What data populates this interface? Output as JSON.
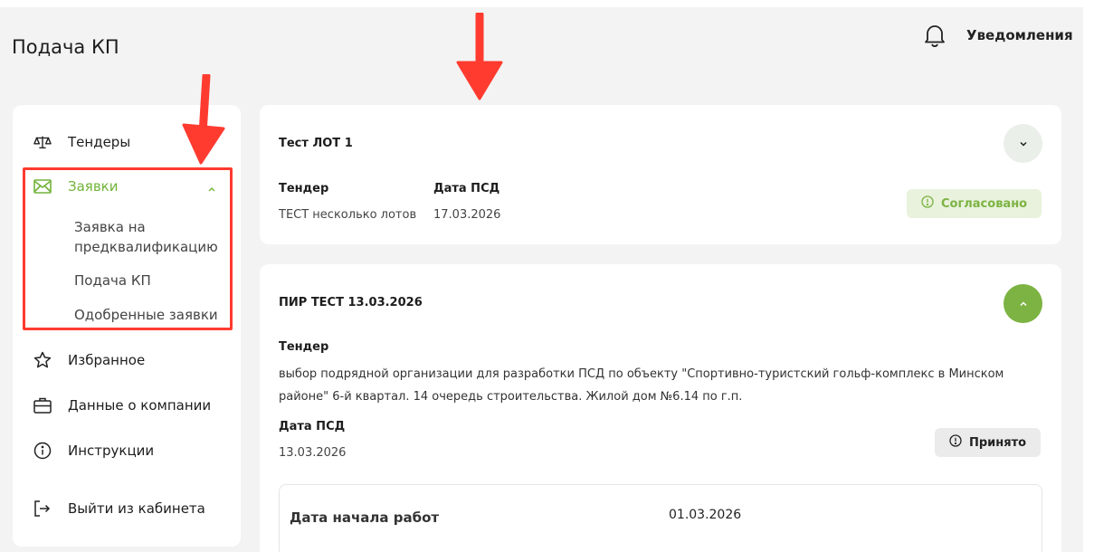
{
  "page": {
    "title": "Подача КП"
  },
  "header": {
    "notifications_label": "Уведомления",
    "notifications_icon": "bell-icon"
  },
  "sidebar": {
    "items": [
      {
        "label": "Тендеры",
        "icon": "scales-icon"
      },
      {
        "label": "Заявки",
        "icon": "envelope-icon",
        "active": true,
        "subitems": [
          {
            "label": "Заявка на предквалификацию"
          },
          {
            "label": "Подача КП"
          },
          {
            "label": "Одобренные заявки"
          }
        ]
      },
      {
        "label": "Избранное",
        "icon": "star-icon"
      },
      {
        "label": "Данные о компании",
        "icon": "briefcase-icon"
      },
      {
        "label": "Инструкции",
        "icon": "info-icon"
      },
      {
        "label": "Выйти из кабинета",
        "icon": "logout-icon"
      }
    ]
  },
  "cards": [
    {
      "title": "Тест ЛОТ 1",
      "tender_label": "Тендер",
      "tender_value": "ТЕСТ несколько лотов",
      "psd_label": "Дата ПСД",
      "psd_value": "17.03.2026",
      "status": "Согласовано",
      "status_color": "#7cb342",
      "expanded": false
    },
    {
      "title": "ПИР ТЕСТ 13.03.2026",
      "tender_label": "Тендер",
      "tender_value": "выбор подрядной организации для разработки ПСД по объекту \"Спортивно-туристский гольф-комплекс в Минском районе\" 6-й квартал. 14 очередь строительства. Жилой дом №6.14 по г.п.",
      "psd_label": "Дата ПСД",
      "psd_value": "13.03.2026",
      "status": "Принято",
      "expanded": true,
      "details": {
        "start_label": "Дата начала работ",
        "start_value": "01.03.2026"
      }
    }
  ],
  "colors": {
    "accent": "#7cb342",
    "annotation": "#ff3b30",
    "background": "#f3f3f3"
  }
}
